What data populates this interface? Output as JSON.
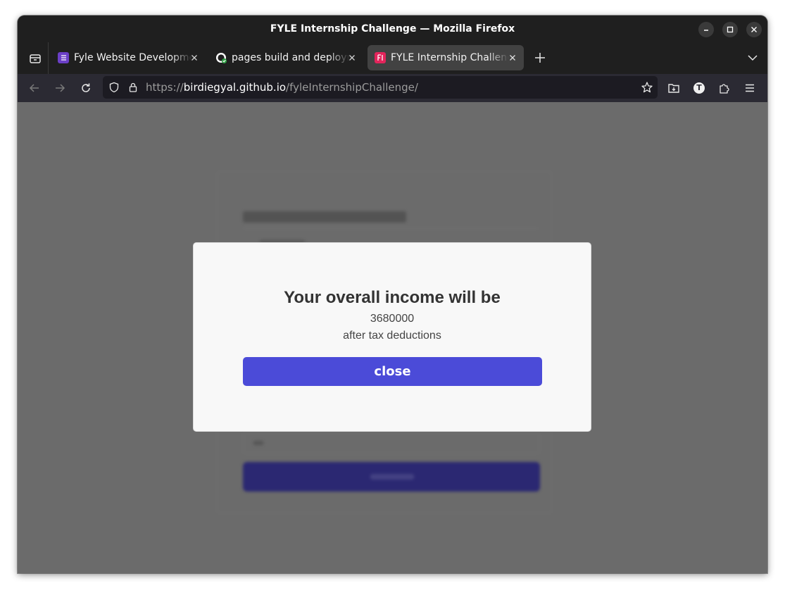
{
  "window": {
    "title": "FYLE Internship Challenge — Mozilla Firefox"
  },
  "tabs": [
    {
      "label": "Fyle Website Development",
      "favicon": "notion-list-icon",
      "favicon_color": "#6b3fc7",
      "active": false
    },
    {
      "label": "pages build and deployment",
      "favicon": "github-icon",
      "favicon_color": "#ffffff",
      "active": false
    },
    {
      "label": "FYLE Internship Challenge",
      "favicon": "fyle-icon",
      "favicon_color": "#e3245b",
      "active": true
    }
  ],
  "urlbar": {
    "scheme": "https://",
    "host": "birdiegyal.github.io",
    "path": "/fyleInternshipChallenge/"
  },
  "toolbar": {
    "account_initial": "T"
  },
  "modal": {
    "heading": "Your overall income will be",
    "amount": "3680000",
    "subtext": "after tax deductions",
    "close_label": "close",
    "button_color": "#4b4bd8"
  }
}
